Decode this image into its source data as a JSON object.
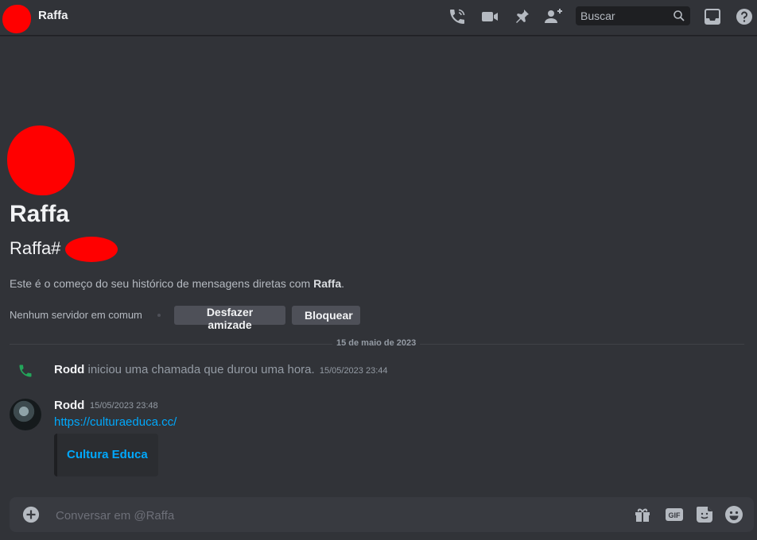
{
  "header": {
    "title": "Raffa",
    "search_placeholder": "Buscar",
    "icons": [
      "phone-call-icon",
      "video-camera-icon",
      "pin-icon",
      "add-friend-icon",
      "search-icon",
      "inbox-icon",
      "help-icon"
    ]
  },
  "intro": {
    "name": "Raffa",
    "tag": "Raffa#",
    "desc_prefix": "Este é o começo do seu histórico de mensagens diretas com ",
    "desc_name": "Raffa",
    "desc_suffix": ".",
    "mutual": "Nenhum servidor em comum",
    "unfriend_label": "Desfazer amizade",
    "block_label": "Bloquear"
  },
  "divider": {
    "date": "15 de maio de 2023"
  },
  "messages": [
    {
      "type": "call",
      "author": "Rodd",
      "text": "iniciou uma chamada que durou uma hora.",
      "timestamp": "15/05/2023 23:44"
    },
    {
      "type": "message",
      "author": "Rodd",
      "timestamp": "15/05/2023 23:48",
      "link": "https://culturaeduca.cc/",
      "embed_title": "Cultura Educa"
    }
  ],
  "composer": {
    "placeholder": "Conversar em @Raffa",
    "icons": [
      "plus-circle-icon",
      "gift-icon",
      "gif-icon",
      "sticker-icon",
      "emoji-icon"
    ]
  },
  "colors": {
    "background": "#313338",
    "link": "#00a8fc",
    "call_green": "#23a55a",
    "button": "#4e5058"
  }
}
